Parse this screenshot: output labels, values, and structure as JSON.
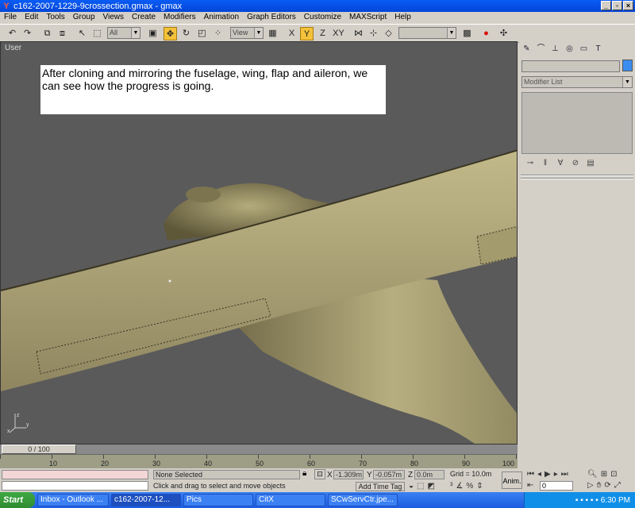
{
  "window": {
    "title": "c162-2007-1229-9crossection.gmax - gmax",
    "controls": [
      "_",
      "▫",
      "×"
    ]
  },
  "menu": [
    "File",
    "Edit",
    "Tools",
    "Group",
    "Views",
    "Create",
    "Modifiers",
    "Animation",
    "Graph Editors",
    "Customize",
    "MAXScript",
    "Help"
  ],
  "toolbar": {
    "selection_filter": "All",
    "reference_coord": "View",
    "named_selection": ""
  },
  "viewport": {
    "label": "User",
    "annotation": "After cloning and mirroring the fuselage, wing, flap and aileron, we can see how the progress is going."
  },
  "command_panel": {
    "modifier_list": "Modifier List",
    "object_color": "#3b8df0"
  },
  "timeline": {
    "slider": "0 / 100",
    "ticks": [
      "10",
      "20",
      "30",
      "40",
      "50",
      "60",
      "70",
      "80",
      "90",
      "100"
    ]
  },
  "status": {
    "selection": "None Selected",
    "prompt": "Click and drag to select and move objects",
    "x_label": "X",
    "x_value": "-1.309m",
    "y_label": "Y",
    "y_value": "-0.057m",
    "z_label": "Z",
    "z_value": "0.0m",
    "grid": "Grid = 10.0m",
    "add_time_tag": "Add Time Tag",
    "anim": "Anim.",
    "frame": "0"
  },
  "taskbar": {
    "start": "Start",
    "tasks": [
      "Inbox - Outlook ...",
      "c162-2007-12...",
      "Pics",
      "CitX",
      "SCwServCtr.jpe..."
    ],
    "time": "6:30 PM"
  }
}
